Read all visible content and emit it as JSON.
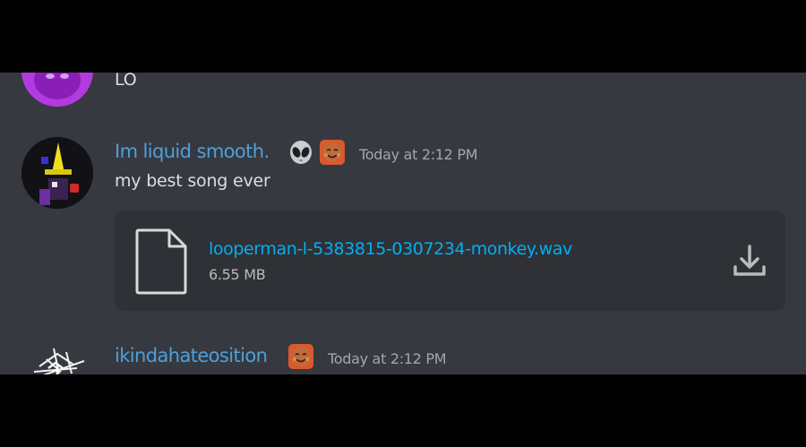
{
  "colors": {
    "background": "#36393f",
    "attachment_bg": "#2f3136",
    "username": "#4f9fdc",
    "link": "#00aff4",
    "text": "#dcddde",
    "timestamp": "#a3a6aa"
  },
  "messages": [
    {
      "text": "LO",
      "avatar_icon": "purple-creature-avatar"
    },
    {
      "username": "Im liquid smooth.",
      "badges": [
        "alien-emoji",
        "smiling-face-emoji"
      ],
      "timestamp": "Today at 2:12 PM",
      "text": "my best song ever",
      "avatar_icon": "wizard-avatar",
      "attachment": {
        "filename": "looperman-l-5383815-0307234-monkey.wav",
        "size": "6.55 MB",
        "file_icon": "document-icon",
        "download_icon": "download-icon"
      }
    },
    {
      "username": "ikindahateosition",
      "badges": [
        "smiling-face-emoji"
      ],
      "timestamp": "Today at 2:12 PM",
      "avatar_icon": "sketch-avatar"
    }
  ]
}
